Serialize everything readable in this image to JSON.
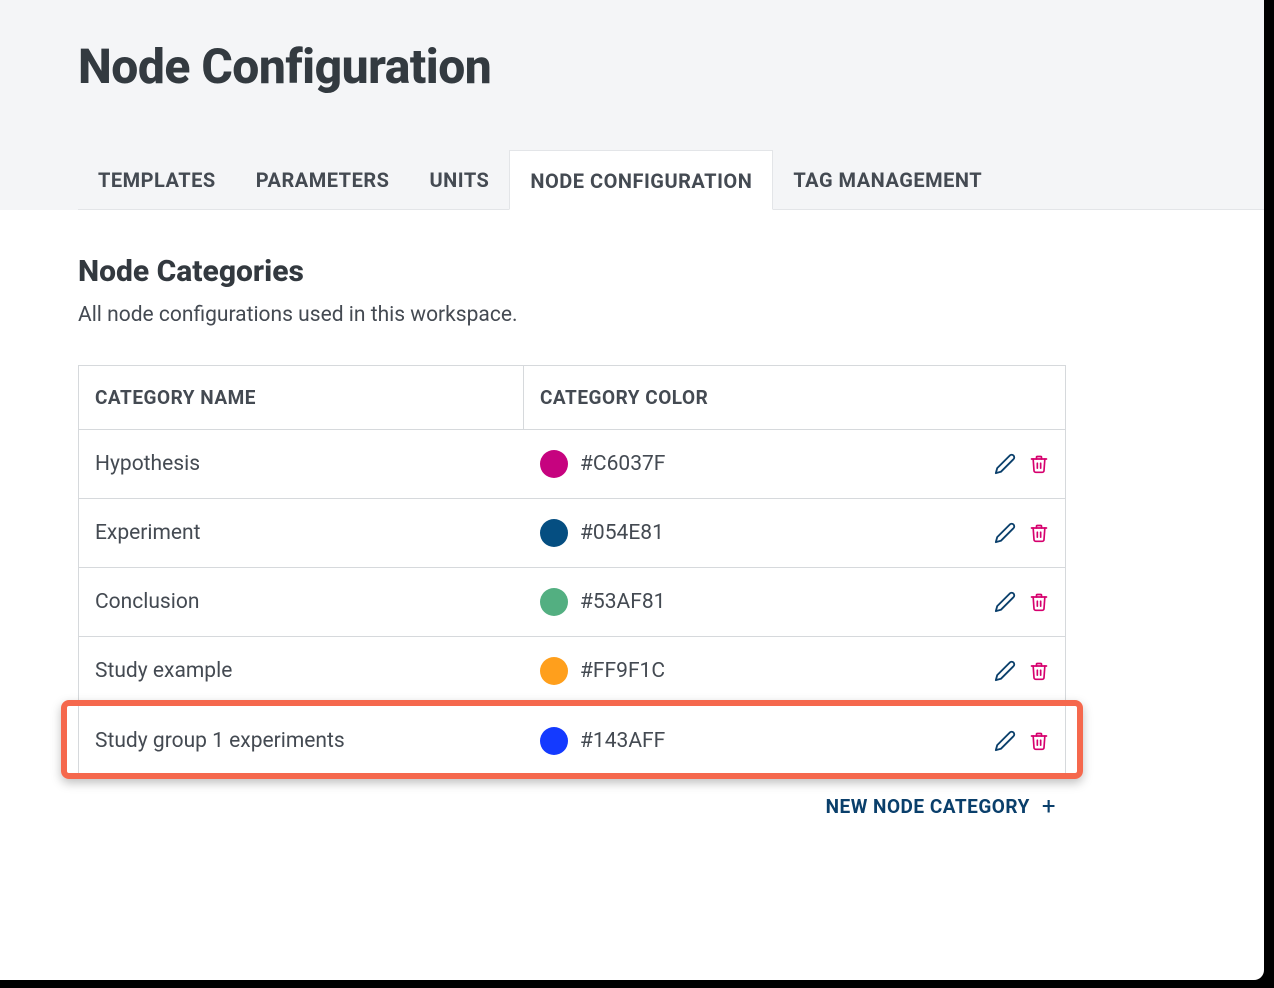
{
  "page_title": "Node Configuration",
  "tabs": [
    {
      "label": "TEMPLATES",
      "active": false
    },
    {
      "label": "PARAMETERS",
      "active": false
    },
    {
      "label": "UNITS",
      "active": false
    },
    {
      "label": "NODE CONFIGURATION",
      "active": true
    },
    {
      "label": "TAG MANAGEMENT",
      "active": false
    }
  ],
  "section": {
    "title": "Node Categories",
    "description": "All node configurations used in this workspace."
  },
  "table": {
    "headers": {
      "name": "CATEGORY NAME",
      "color": "CATEGORY COLOR"
    },
    "rows": [
      {
        "name": "Hypothesis",
        "color_label": "#C6037F",
        "swatch": "#C6037F",
        "highlighted": false
      },
      {
        "name": "Experiment",
        "color_label": "#054E81",
        "swatch": "#054E81",
        "highlighted": false
      },
      {
        "name": "Conclusion",
        "color_label": "#53AF81",
        "swatch": "#53AF81",
        "highlighted": false
      },
      {
        "name": "Study example",
        "color_label": "#FF9F1C",
        "swatch": "#FF9F1C",
        "highlighted": false
      },
      {
        "name": "Study group 1 experiments",
        "color_label": "#143AFF",
        "swatch": "#143AFF",
        "highlighted": true
      }
    ]
  },
  "new_category_label": "NEW NODE CATEGORY",
  "icons": {
    "edit_color": "#0a3f6b",
    "delete_color": "#d6006e"
  }
}
